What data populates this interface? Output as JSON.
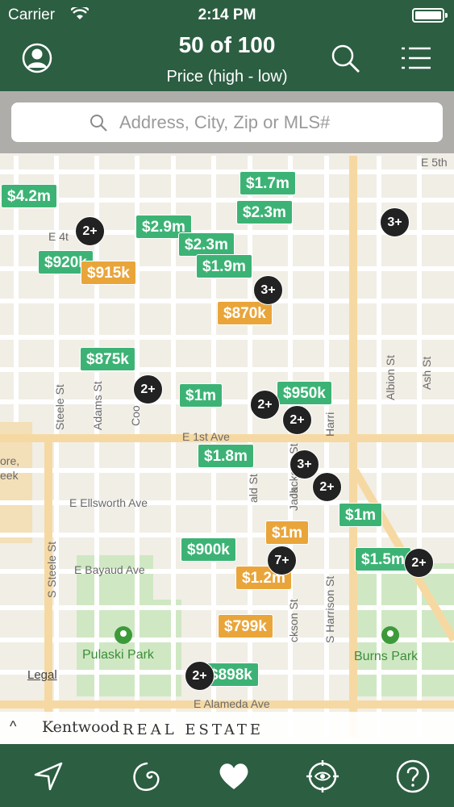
{
  "status": {
    "carrier": "Carrier",
    "time": "2:14 PM"
  },
  "header": {
    "title": "50 of 100",
    "subtitle": "Price (high - low)"
  },
  "search": {
    "placeholder": "Address, City, Zip or MLS#"
  },
  "map": {
    "street_labels": [
      "E 5th",
      "E 4t",
      "E 1st Ave",
      "E Ellsworth Ave",
      "E Bayaud Ave",
      "E Alameda Ave",
      "ore,",
      "eek"
    ],
    "vertical_labels": [
      "Steele St",
      "Adams St",
      "Coo",
      "S Steele St",
      "Albion St",
      "Ash St",
      "Harri",
      "S Harrison St",
      "Jackson St",
      "ald St",
      "Jack",
      "ckson St"
    ],
    "parks": [
      "Pulaski Park",
      "Burns Park"
    ],
    "price_pins": [
      {
        "label": "$4.2m",
        "color": "green"
      },
      {
        "label": "$1.7m",
        "color": "green"
      },
      {
        "label": "$2.3m",
        "color": "green"
      },
      {
        "label": "$2.9m",
        "color": "green"
      },
      {
        "label": "$2.3m",
        "color": "green"
      },
      {
        "label": "$920k",
        "color": "green"
      },
      {
        "label": "$915k",
        "color": "orange"
      },
      {
        "label": "$1.9m",
        "color": "green"
      },
      {
        "label": "$870k",
        "color": "orange"
      },
      {
        "label": "$875k",
        "color": "green"
      },
      {
        "label": "$1m",
        "color": "green"
      },
      {
        "label": "$950k",
        "color": "green"
      },
      {
        "label": "$1.8m",
        "color": "green"
      },
      {
        "label": "$1m",
        "color": "green"
      },
      {
        "label": "$1m",
        "color": "orange"
      },
      {
        "label": "$900k",
        "color": "green"
      },
      {
        "label": "$1.5m",
        "color": "green"
      },
      {
        "label": "$1.2m",
        "color": "orange"
      },
      {
        "label": "$799k",
        "color": "orange"
      },
      {
        "label": "$898k",
        "color": "green"
      }
    ],
    "clusters": [
      "2+",
      "3+",
      "3+",
      "2+",
      "2+",
      "2+",
      "3+",
      "2+",
      "7+",
      "2+",
      "2+"
    ],
    "legal": "Legal"
  },
  "brand": {
    "caret": "^",
    "logo": "Kentwood",
    "text": "REAL ESTATE"
  },
  "icons": {
    "profile": "user-circle-icon",
    "search": "magnifier-icon",
    "list": "list-icon",
    "nav": "location-arrow-icon",
    "draw": "lasso-icon",
    "favorites": "heart-icon",
    "target": "eye-target-icon",
    "help": "question-circle-icon"
  },
  "colors": {
    "brand_green": "#2c5e42",
    "pin_green": "#3cb375",
    "pin_orange": "#e9a53a",
    "cluster": "#222222"
  }
}
